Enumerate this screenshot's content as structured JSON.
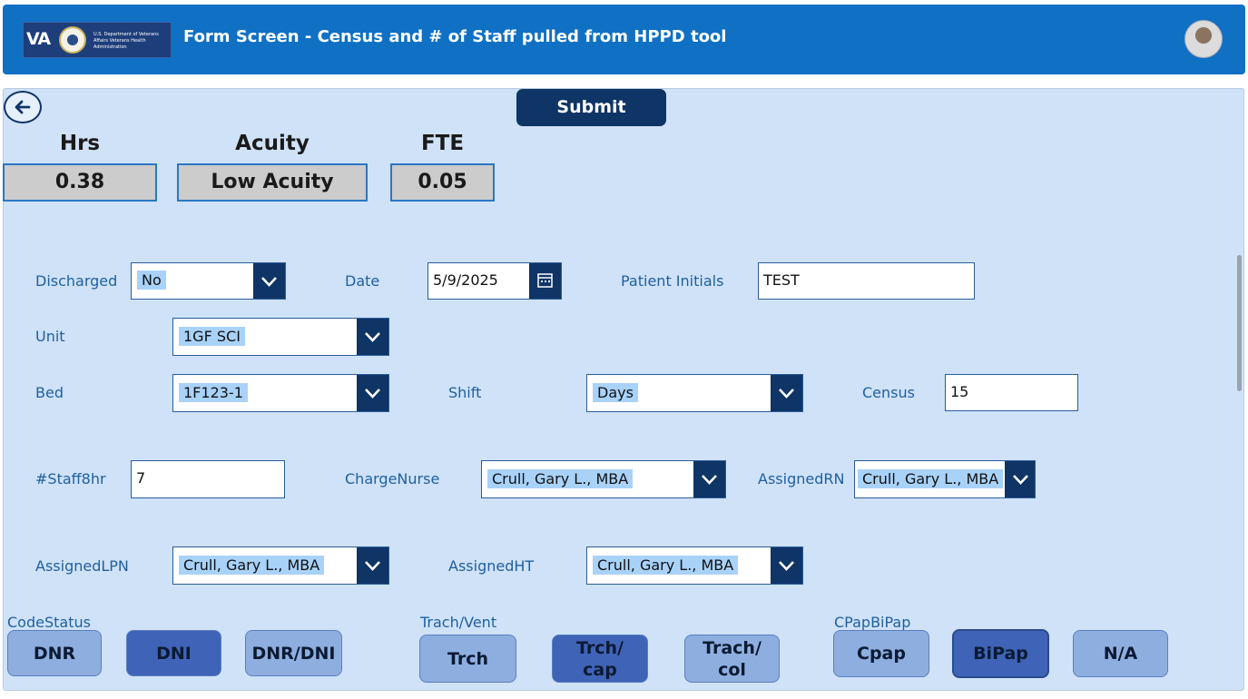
{
  "header": {
    "logo_text": "VA",
    "logo_dept": "U.S. Department of Veterans Affairs Veterans Health Administration",
    "title": "Form Screen - Census and # of Staff pulled from HPPD tool"
  },
  "toolbar": {
    "submit_label": "Submit"
  },
  "metrics": {
    "hrs": {
      "label": "Hrs",
      "value": "0.38"
    },
    "acuity": {
      "label": "Acuity",
      "value": "Low Acuity"
    },
    "fte": {
      "label": "FTE",
      "value": "0.05"
    }
  },
  "form": {
    "discharged": {
      "label": "Discharged",
      "value": "No"
    },
    "date": {
      "label": "Date",
      "value": "5/9/2025"
    },
    "patient_initials": {
      "label": "Patient Initials",
      "value": "TEST"
    },
    "unit": {
      "label": "Unit",
      "value": "1GF SCI"
    },
    "bed": {
      "label": "Bed",
      "value": "1F123-1"
    },
    "shift": {
      "label": "Shift",
      "value": "Days"
    },
    "census": {
      "label": "Census",
      "value": "15"
    },
    "staff8hr": {
      "label": "#Staff8hr",
      "value": "7"
    },
    "charge_nurse": {
      "label": "ChargeNurse",
      "value": "Crull, Gary L., MBA"
    },
    "assigned_rn": {
      "label": "AssignedRN",
      "value": "Crull, Gary L., MBA"
    },
    "assigned_lpn": {
      "label": "AssignedLPN",
      "value": "Crull, Gary L., MBA"
    },
    "assigned_ht": {
      "label": "AssignedHT",
      "value": "Crull, Gary L., MBA"
    }
  },
  "code_status": {
    "label": "CodeStatus",
    "options": [
      "DNR",
      "DNI",
      "DNR/DNI"
    ],
    "selected": "DNI"
  },
  "trach_vent": {
    "label": "Trach/Vent",
    "options": [
      "Trch",
      "Trch/ cap",
      "Trach/ col"
    ],
    "selected": "Trch/ cap"
  },
  "cpap_bipap": {
    "label": "CPapBiPap",
    "options": [
      "Cpap",
      "BiPap",
      "N/A"
    ],
    "selected": "BiPap"
  },
  "colors": {
    "header_bg": "#1070c4",
    "panel_bg": "#cfe2f8",
    "navy": "#0f3466",
    "label_blue": "#1f5f9e",
    "selected_highlight": "#a9d2f9",
    "option_light": "#8eaee0",
    "option_selected": "#3f63b6"
  },
  "icons": {
    "back": "arrow-left-icon",
    "dropdown": "chevron-down-icon",
    "calendar": "calendar-icon"
  }
}
